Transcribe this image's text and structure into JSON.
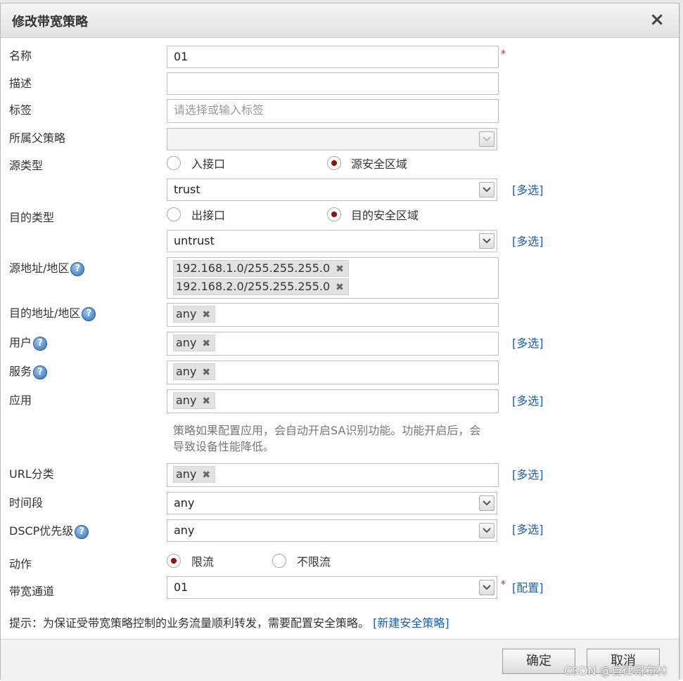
{
  "dialog": {
    "title": "修改带宽策略",
    "close_label": "×"
  },
  "form": {
    "name": {
      "label": "名称",
      "value": "01",
      "required": "*"
    },
    "description": {
      "label": "描述",
      "value": ""
    },
    "tags": {
      "label": "标签",
      "placeholder": "请选择或输入标签"
    },
    "parent_policy": {
      "label": "所属父策略",
      "value": ""
    },
    "source_type": {
      "label": "源类型",
      "options": [
        "入接口",
        "源安全区域"
      ],
      "selected": "源安全区域",
      "select_value": "trust",
      "multi_link": "[多选]"
    },
    "dest_type": {
      "label": "目的类型",
      "options": [
        "出接口",
        "目的安全区域"
      ],
      "selected": "目的安全区域",
      "select_value": "untrust",
      "multi_link": "[多选]"
    },
    "source_address": {
      "label": "源地址/地区",
      "help": "?",
      "tags": [
        "192.168.1.0/255.255.255.0",
        "192.168.2.0/255.255.255.0"
      ]
    },
    "dest_address": {
      "label": "目的地址/地区",
      "help": "?",
      "tags": [
        "any"
      ]
    },
    "user": {
      "label": "用户",
      "help": "?",
      "tags": [
        "any"
      ],
      "multi_link": "[多选]"
    },
    "service": {
      "label": "服务",
      "help": "?",
      "tags": [
        "any"
      ]
    },
    "application": {
      "label": "应用",
      "tags": [
        "any"
      ],
      "multi_link": "[多选]",
      "note": "策略如果配置应用，会自动开启SA识别功能。功能开启后，会导致设备性能降低。"
    },
    "url_category": {
      "label": "URL分类",
      "tags": [
        "any"
      ],
      "multi_link": "[多选]"
    },
    "time_range": {
      "label": "时间段",
      "value": "any"
    },
    "dscp": {
      "label": "DSCP优先级",
      "help": "?",
      "value": "any",
      "multi_link": "[多选]"
    },
    "action": {
      "label": "动作",
      "options": [
        "限流",
        "不限流"
      ],
      "selected": "限流"
    },
    "bandwidth_channel": {
      "label": "带宽通道",
      "value": "01",
      "required": "*",
      "config_link": "[配置]"
    }
  },
  "tip": {
    "text": "提示：为保证受带宽策略控制的业务流量顺利转发，需要配置安全策略。",
    "link": "[新建安全策略]"
  },
  "footer": {
    "confirm_label": "确定",
    "cancel_label": "取消"
  },
  "watermark": "CSDN @自律哥布林",
  "colors": {
    "link": "#1a5fb4",
    "required": "#e02020",
    "radio_selected": "#8b1010"
  }
}
